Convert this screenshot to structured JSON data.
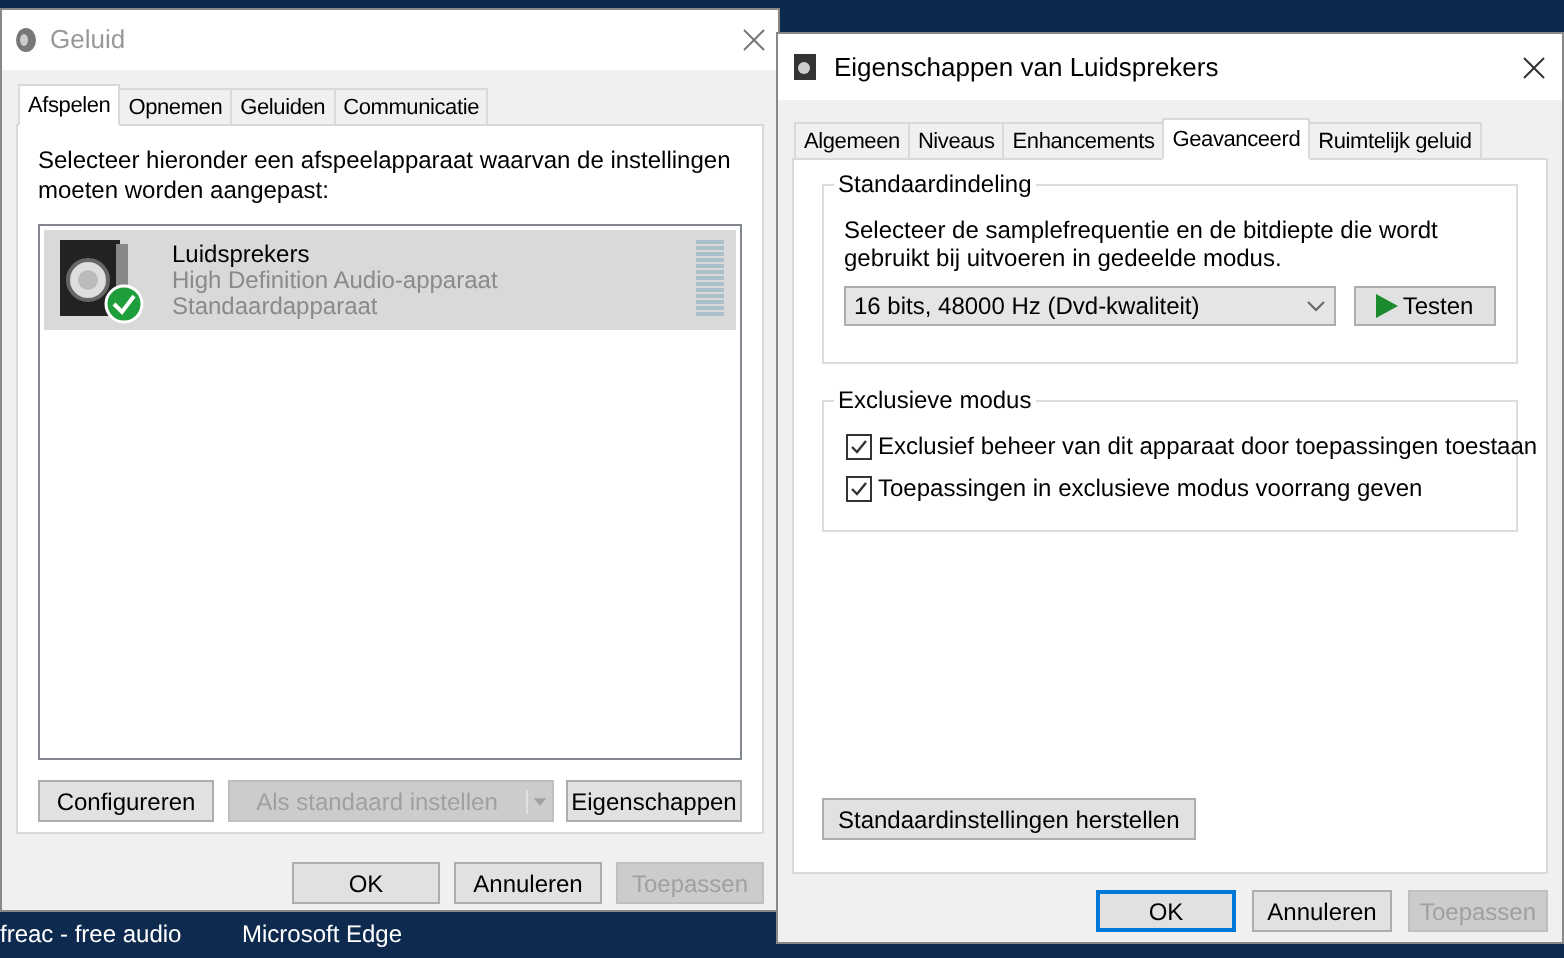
{
  "taskbar": {
    "items": [
      "freac - free audio",
      "Microsoft Edge"
    ]
  },
  "sound_dialog": {
    "title": "Geluid",
    "tabs": [
      {
        "label": "Afspelen",
        "selected": true
      },
      {
        "label": "Opnemen",
        "selected": false
      },
      {
        "label": "Geluiden",
        "selected": false
      },
      {
        "label": "Communicatie",
        "selected": false
      }
    ],
    "instruction": "Selecteer hieronder een afspeelapparaat waarvan de instellingen moeten worden aangepast:",
    "devices": [
      {
        "name": "Luidsprekers",
        "description": "High Definition Audio-apparaat",
        "status": "Standaardapparaat",
        "selected": true,
        "is_default": true
      }
    ],
    "device_buttons": [
      {
        "label": "Configureren",
        "disabled": false,
        "kind": "plain"
      },
      {
        "label": "Als standaard instellen",
        "disabled": true,
        "kind": "split"
      },
      {
        "label": "Eigenschappen",
        "disabled": false,
        "kind": "plain"
      }
    ],
    "buttons": [
      {
        "label": "OK",
        "disabled": false,
        "default": false
      },
      {
        "label": "Annuleren",
        "disabled": false,
        "default": false
      },
      {
        "label": "Toepassen",
        "disabled": true,
        "default": false
      }
    ]
  },
  "properties_dialog": {
    "title": "Eigenschappen van Luidsprekers",
    "tabs": [
      {
        "label": "Algemeen",
        "selected": false
      },
      {
        "label": "Niveaus",
        "selected": false
      },
      {
        "label": "Enhancements",
        "selected": false
      },
      {
        "label": "Geavanceerd",
        "selected": true
      },
      {
        "label": "Ruimtelijk geluid",
        "selected": false
      }
    ],
    "default_format": {
      "title": "Standaardindeling",
      "description": "Selecteer de samplefrequentie en de bitdiepte die wordt gebruikt bij uitvoeren in gedeelde modus.",
      "format": "16 bits, 48000 Hz (Dvd-kwaliteit)",
      "test_button": "Testen"
    },
    "exclusive_mode": {
      "title": "Exclusieve modus",
      "options": [
        {
          "label": "Exclusief beheer van dit apparaat door toepassingen toestaan",
          "checked": true
        },
        {
          "label": "Toepassingen in exclusieve modus voorrang geven",
          "checked": true
        }
      ]
    },
    "restore_button": "Standaardinstellingen herstellen",
    "buttons": [
      {
        "label": "OK",
        "disabled": false,
        "default": true
      },
      {
        "label": "Annuleren",
        "disabled": false,
        "default": false
      },
      {
        "label": "Toepassen",
        "disabled": true,
        "default": false
      }
    ]
  }
}
